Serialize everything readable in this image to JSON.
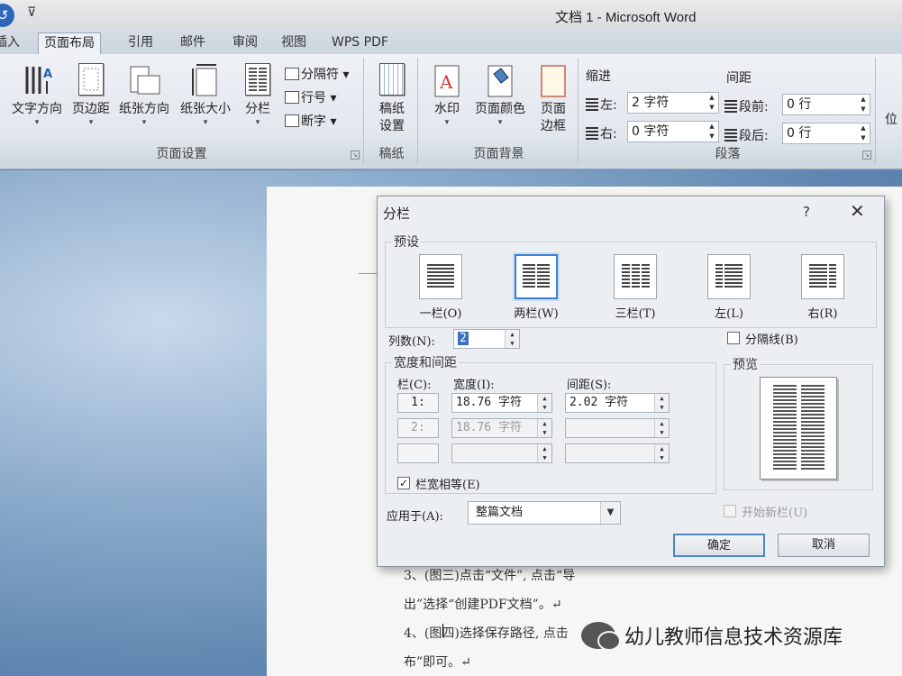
{
  "window": {
    "title": "文档 1 - Microsoft Word",
    "qa_caret": "⊽"
  },
  "tabs": [
    "插入",
    "页面布局",
    "引用",
    "邮件",
    "审阅",
    "视图",
    "WPS PDF"
  ],
  "ribbon": {
    "page_setup": {
      "label": "页面设置",
      "buttons": [
        "文字方向",
        "页边距",
        "纸张方向",
        "纸张大小",
        "分栏"
      ],
      "small": [
        "分隔符",
        "行号",
        "断字"
      ]
    },
    "manuscript": {
      "label": "稿纸",
      "button": "稿纸\n设置"
    },
    "page_background": {
      "label": "页面背景",
      "buttons": [
        "水印",
        "页面颜色",
        "页面\n边框"
      ]
    },
    "paragraph": {
      "label": "段落",
      "indent": {
        "title": "缩进",
        "left_label": "左:",
        "left_value": "2 字符",
        "right_label": "右:",
        "right_value": "0 字符"
      },
      "spacing": {
        "title": "间距",
        "before_label": "段前:",
        "before_value": "0 行",
        "after_label": "段后:",
        "after_value": "0 行"
      }
    },
    "position_partial": "位"
  },
  "document": {
    "lines": [
      "3、(图三)点击“文件”, 点击“导",
      "出”选择“创建PDF文档”。↵",
      "4、(图四)选择保存路径, 点击",
      "布”即可。↵"
    ]
  },
  "watermark": {
    "text": "幼儿教师信息技术资源库"
  },
  "dialog": {
    "title": "分栏",
    "help": "?",
    "close": "✕",
    "presets_label": "预设",
    "presets": [
      {
        "label": "一栏(O)",
        "cols": 1
      },
      {
        "label": "两栏(W)",
        "cols": 2
      },
      {
        "label": "三栏(T)",
        "cols": 3
      },
      {
        "label": "左(L)",
        "cols": 2
      },
      {
        "label": "右(R)",
        "cols": 2
      }
    ],
    "selected_preset": "两栏(W)",
    "num_cols_label": "列数(N):",
    "num_cols_value": "2",
    "separator_label": "分隔线(B)",
    "width_spacing_label": "宽度和间距",
    "col_header": "栏(C):",
    "width_header": "宽度(I):",
    "spacing_header": "间距(S):",
    "rows": [
      {
        "col": "1:",
        "width": "18.76 字符",
        "spacing": "2.02 字符"
      },
      {
        "col": "2:",
        "width": "18.76 字符",
        "spacing": ""
      },
      {
        "col": "",
        "width": "",
        "spacing": ""
      }
    ],
    "equal_width_label": "栏宽相等(E)",
    "equal_width_checked": "✓",
    "preview_label": "预览",
    "apply_label": "应用于(A):",
    "apply_value": "整篇文档",
    "new_col_label": "开始新栏(U)",
    "ok": "确定",
    "cancel": "取消"
  }
}
